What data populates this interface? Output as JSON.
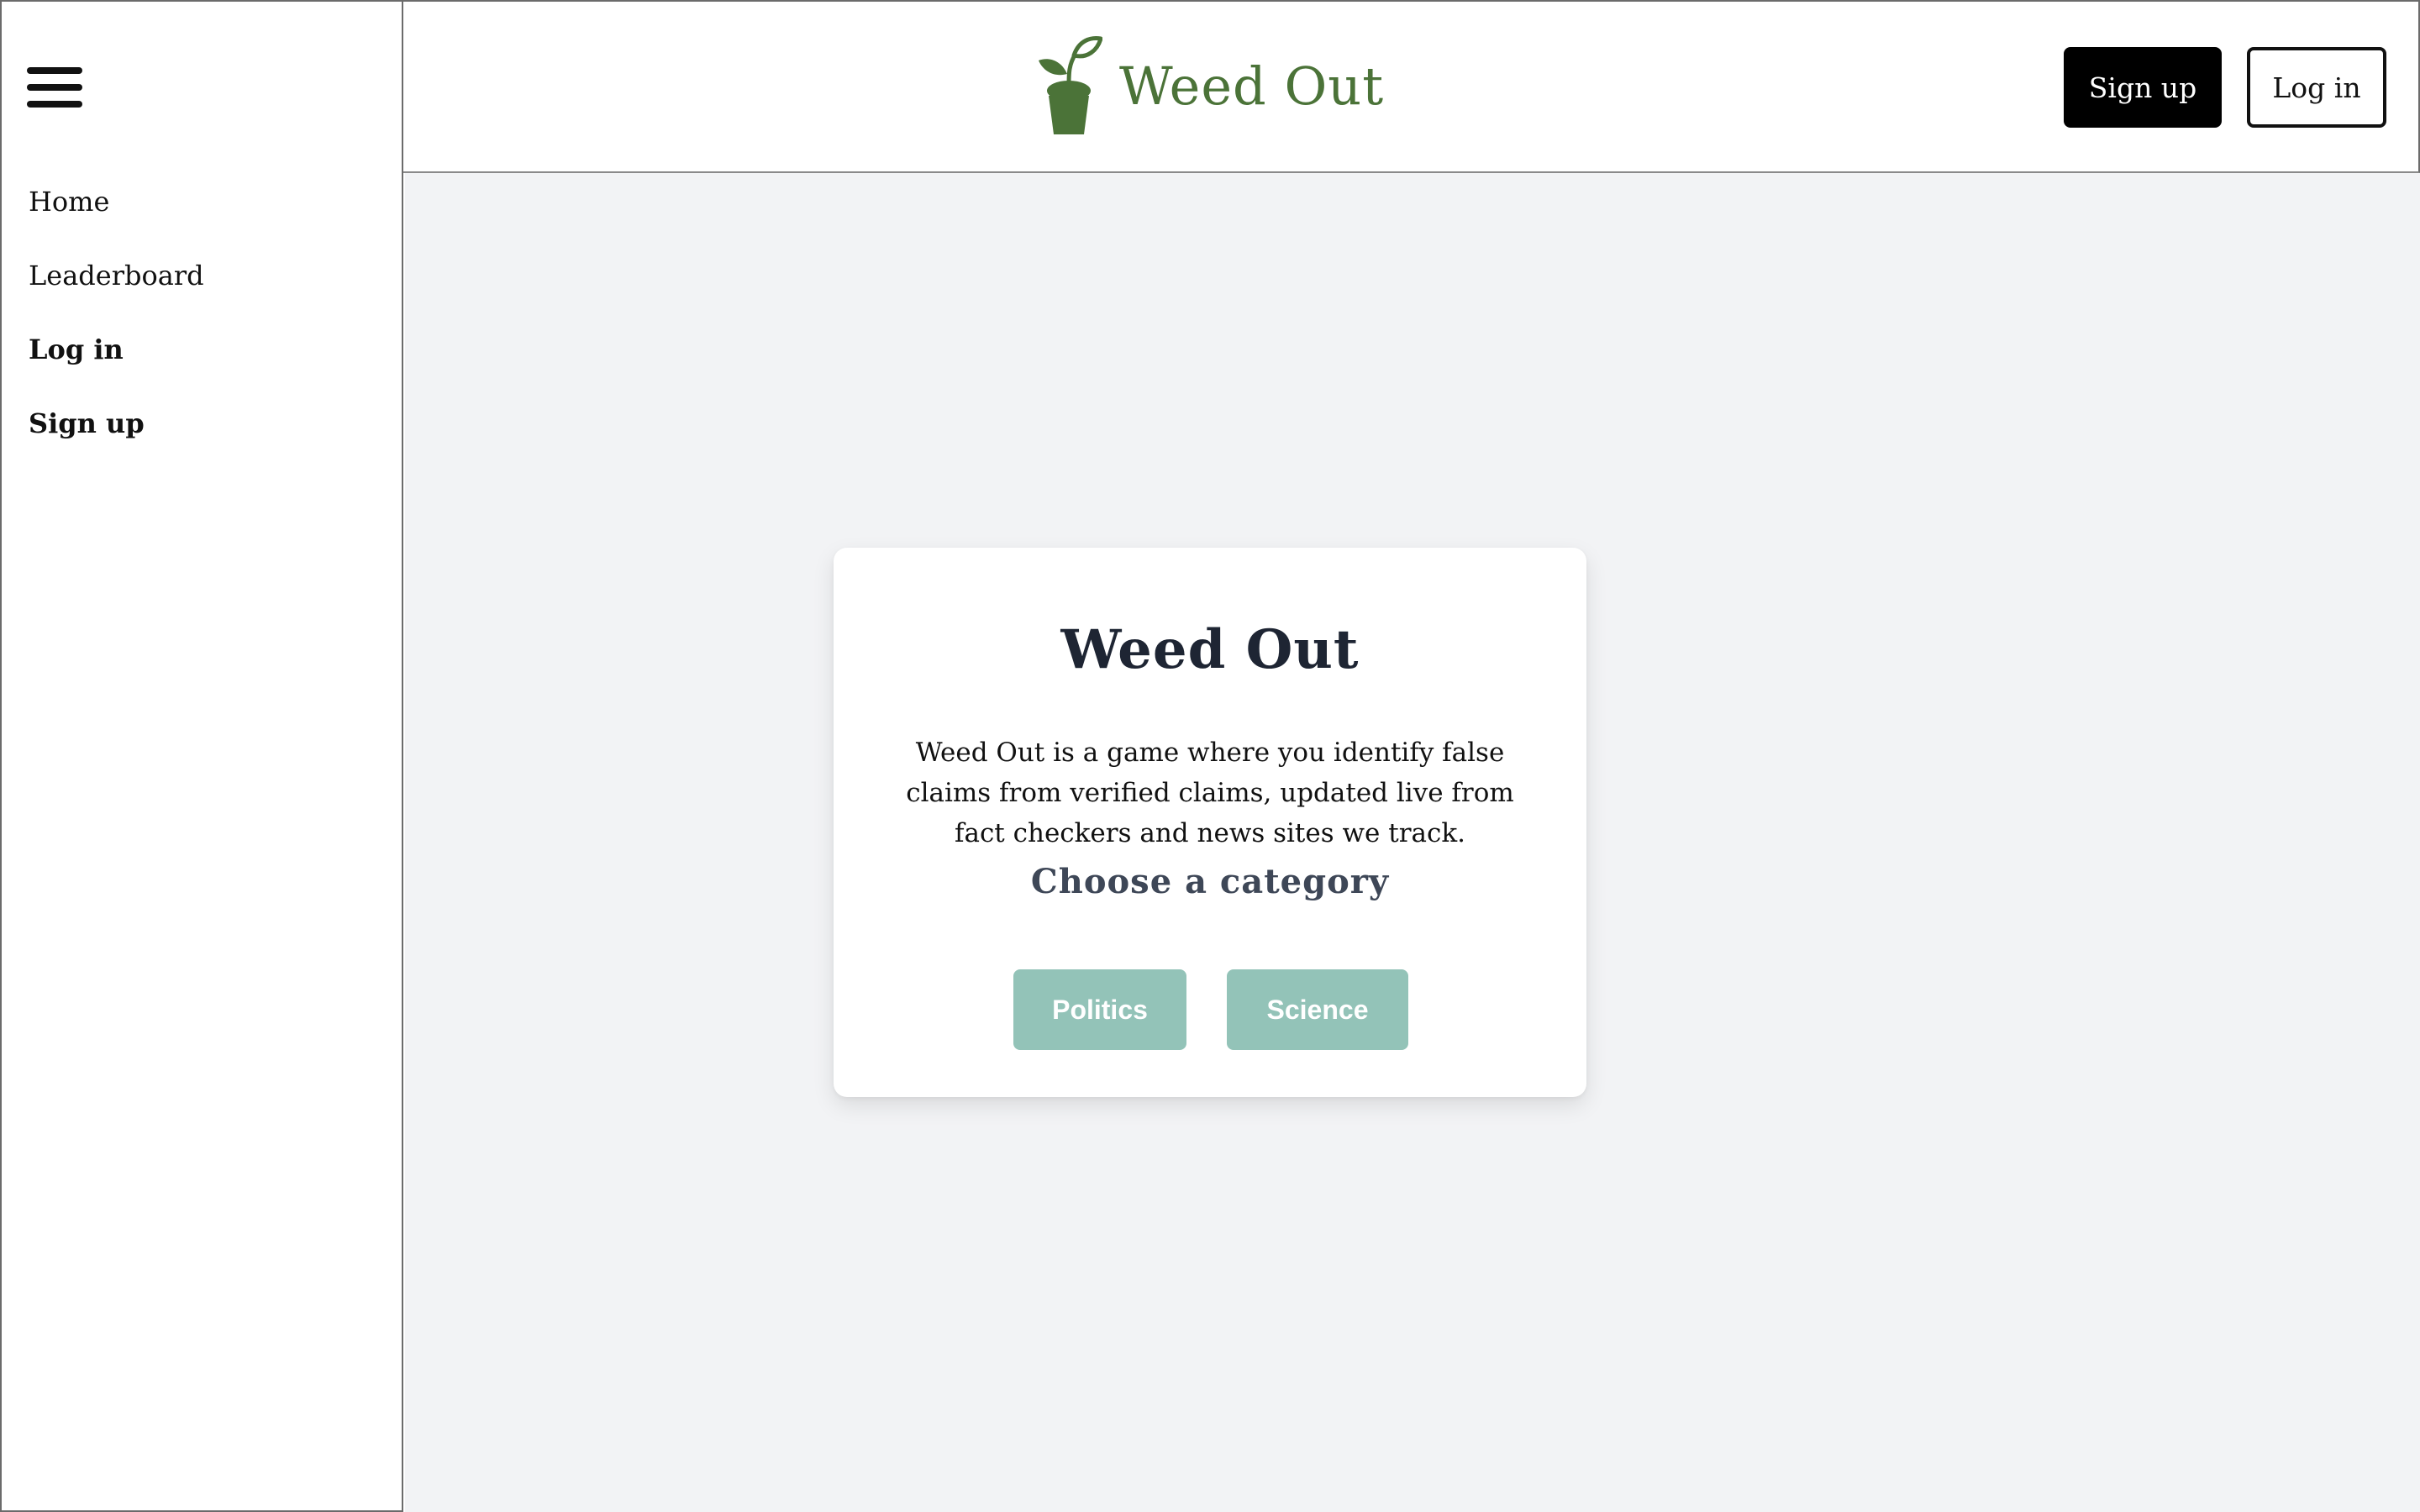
{
  "sidebar": {
    "menu_icon": "hamburger-menu-icon",
    "items": [
      {
        "label": "Home",
        "bold": false
      },
      {
        "label": "Leaderboard",
        "bold": false
      },
      {
        "label": "Log in",
        "bold": true
      },
      {
        "label": "Sign up",
        "bold": true
      }
    ]
  },
  "header": {
    "logo_icon": "sprout-pot-icon",
    "brand_name": "Weed Out",
    "brand_color": "#4b7338",
    "signup_label": "Sign up",
    "login_label": "Log in"
  },
  "card": {
    "title": "Weed Out",
    "description": "Weed Out is a game where you identify false claims from verified claims, updated live from fact checkers and news sites we track.",
    "subtitle": "Choose a category",
    "categories": [
      "Politics",
      "Science"
    ],
    "category_color": "#93c3b8"
  }
}
